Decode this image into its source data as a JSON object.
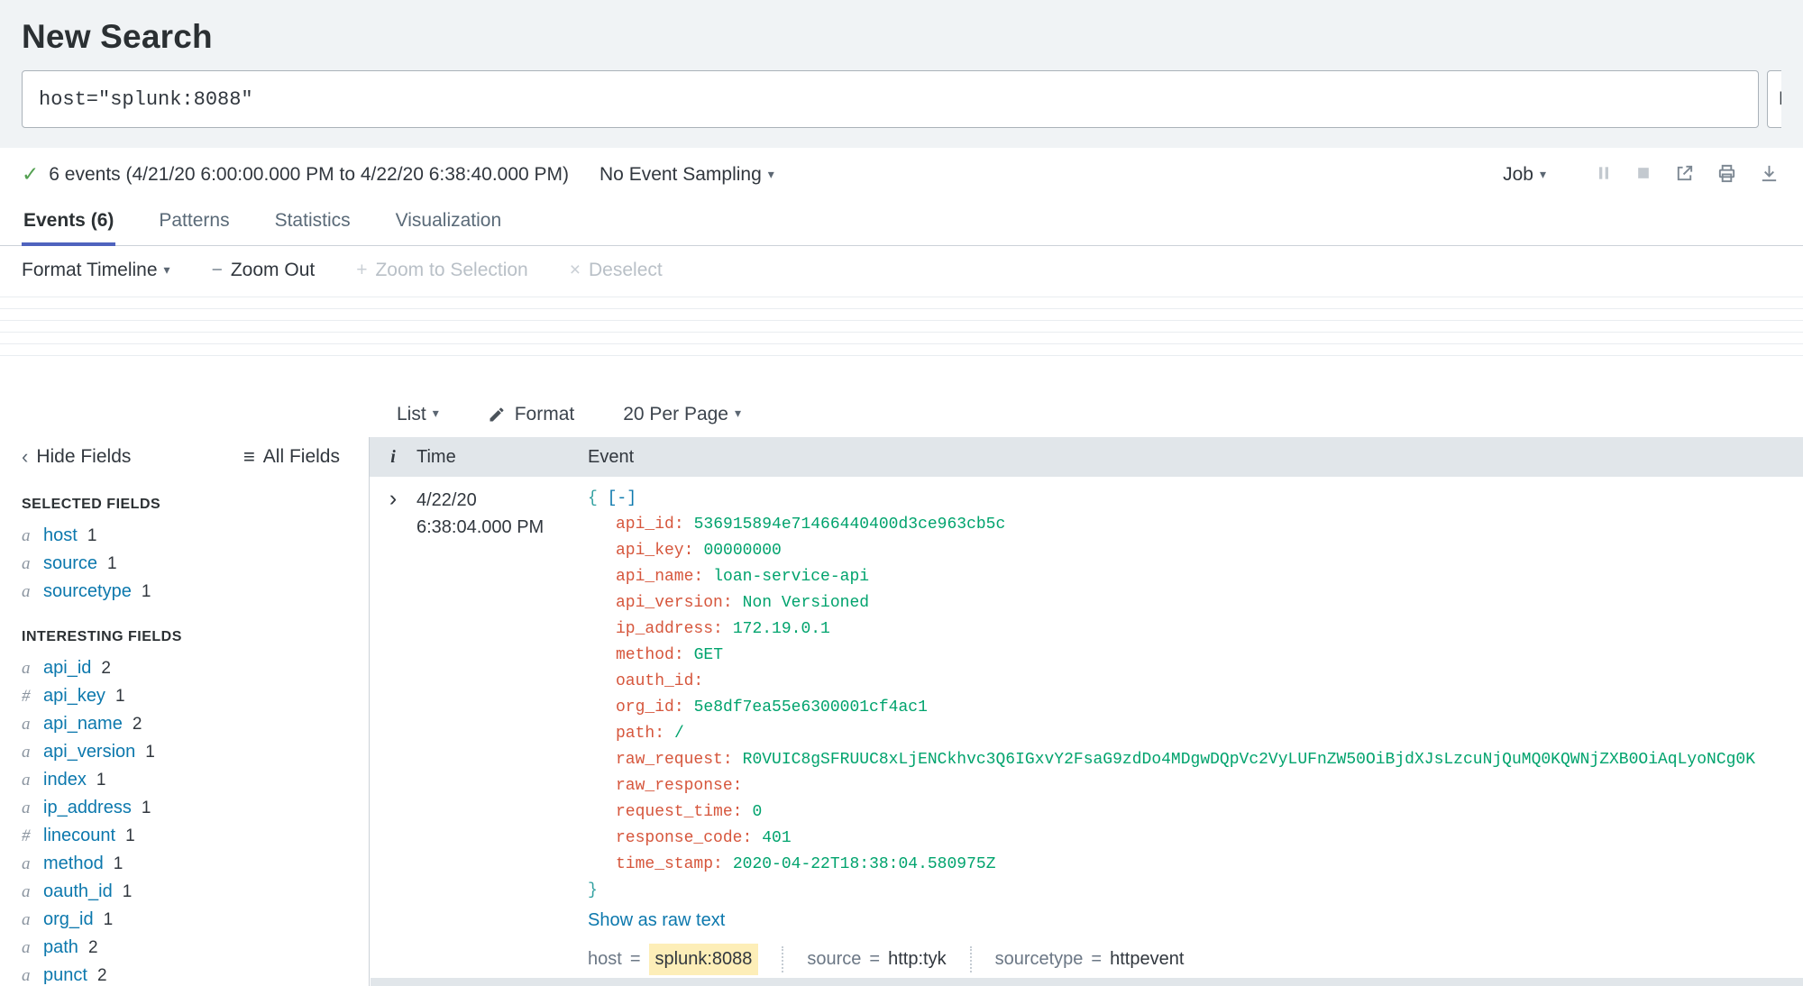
{
  "header": {
    "title": "New Search",
    "query": "host=\"splunk:8088\"",
    "time_range_clipped": "L"
  },
  "status": {
    "summary": "6 events (4/21/20 6:00:00.000 PM to 4/22/20 6:38:40.000 PM)",
    "sampling_label": "No Event Sampling",
    "job_label": "Job"
  },
  "icons": {
    "check": "✓",
    "caret_down": "▾",
    "chevron_left": "‹",
    "chevron_right": "›",
    "list_menu": "≡",
    "minus": "−",
    "plus": "+",
    "close": "×"
  },
  "symbols": {
    "colon": ":",
    "equals": "="
  },
  "tabs": [
    {
      "label": "Events (6)",
      "active": true
    },
    {
      "label": "Patterns",
      "active": false
    },
    {
      "label": "Statistics",
      "active": false
    },
    {
      "label": "Visualization",
      "active": false
    }
  ],
  "timeline_toolbar": {
    "format_timeline": "Format Timeline",
    "zoom_out": "Zoom Out",
    "zoom_to_selection": "Zoom to Selection",
    "deselect": "Deselect"
  },
  "results_toolbar": {
    "list_label": "List",
    "format_label": "Format",
    "per_page_label": "20 Per Page"
  },
  "fields_sidebar": {
    "hide_fields": "Hide Fields",
    "all_fields": "All Fields",
    "selected_heading": "SELECTED FIELDS",
    "interesting_heading": "INTERESTING FIELDS",
    "selected": [
      {
        "type": "a",
        "name": "host",
        "count": "1"
      },
      {
        "type": "a",
        "name": "source",
        "count": "1"
      },
      {
        "type": "a",
        "name": "sourcetype",
        "count": "1"
      }
    ],
    "interesting": [
      {
        "type": "a",
        "name": "api_id",
        "count": "2"
      },
      {
        "type": "#",
        "name": "api_key",
        "count": "1"
      },
      {
        "type": "a",
        "name": "api_name",
        "count": "2"
      },
      {
        "type": "a",
        "name": "api_version",
        "count": "1"
      },
      {
        "type": "a",
        "name": "index",
        "count": "1"
      },
      {
        "type": "a",
        "name": "ip_address",
        "count": "1"
      },
      {
        "type": "#",
        "name": "linecount",
        "count": "1"
      },
      {
        "type": "a",
        "name": "method",
        "count": "1"
      },
      {
        "type": "a",
        "name": "oauth_id",
        "count": "1"
      },
      {
        "type": "a",
        "name": "org_id",
        "count": "1"
      },
      {
        "type": "a",
        "name": "path",
        "count": "2"
      },
      {
        "type": "a",
        "name": "punct",
        "count": "2"
      }
    ]
  },
  "events_table": {
    "columns": {
      "info": "i",
      "time": "Time",
      "event": "Event"
    },
    "rows": [
      {
        "date": "4/22/20",
        "time": "6:38:04.000 PM",
        "open_brace": "{",
        "collapse_link": "[-]",
        "close_brace": "}",
        "json_fields": [
          {
            "key": "api_id",
            "value": "536915894e71466440400d3ce963cb5c"
          },
          {
            "key": "api_key",
            "value": "00000000"
          },
          {
            "key": "api_name",
            "value": "loan-service-api"
          },
          {
            "key": "api_version",
            "value": "Non Versioned"
          },
          {
            "key": "ip_address",
            "value": "172.19.0.1"
          },
          {
            "key": "method",
            "value": "GET"
          },
          {
            "key": "oauth_id",
            "value": ""
          },
          {
            "key": "org_id",
            "value": "5e8df7ea55e6300001cf4ac1"
          },
          {
            "key": "path",
            "value": "/"
          },
          {
            "key": "raw_request",
            "value": "R0VUIC8gSFRUUC8xLjENCkhvc3Q6IGxvY2FsaG9zdDo4MDgwDQpVc2VyLUFnZW50OiBjdXJsLzcuNjQuMQ0KQWNjZXB0OiAqLyoNCg0K"
          },
          {
            "key": "raw_response",
            "value": ""
          },
          {
            "key": "request_time",
            "value": "0"
          },
          {
            "key": "response_code",
            "value": "401"
          },
          {
            "key": "time_stamp",
            "value": "2020-04-22T18:38:04.580975Z"
          }
        ],
        "show_raw_label": "Show as raw text",
        "meta": [
          {
            "key": "host",
            "value": "splunk:8088",
            "highlight": true
          },
          {
            "key": "source",
            "value": "http:tyk"
          },
          {
            "key": "sourcetype",
            "value": "httpevent"
          }
        ]
      }
    ]
  }
}
